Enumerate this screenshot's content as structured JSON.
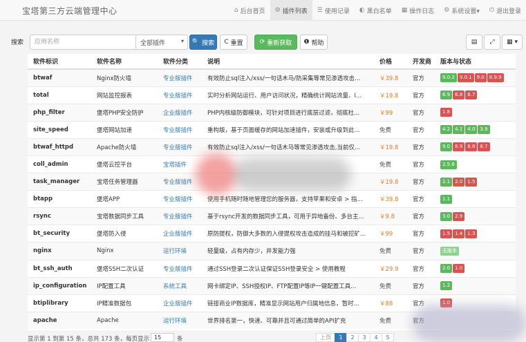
{
  "app": {
    "brand": "宝塔第三方云端管理中心"
  },
  "nav": [
    {
      "label": "后台首页",
      "icon": "⌂",
      "active": false
    },
    {
      "label": "插件列表",
      "icon": "⚙",
      "active": true
    },
    {
      "label": "使用记录",
      "icon": "☰",
      "active": false
    },
    {
      "label": "黑白名单",
      "icon": "◐",
      "active": false
    },
    {
      "label": "操作日志",
      "icon": "▦",
      "active": false
    },
    {
      "label": "系统设置▾",
      "icon": "⚙",
      "active": false
    },
    {
      "label": "退出登录",
      "icon": "⏻",
      "active": false
    }
  ],
  "toolbar": {
    "search_label": "搜索",
    "search_placeholder": "应用名称",
    "search_value": "",
    "category_select": "全部插件",
    "search_button": "搜索",
    "reset_button": "重置",
    "refresh_button": "重新获取",
    "help_button": "帮助",
    "icons": {
      "search": "🔍",
      "reset": "C",
      "refresh": "⟳",
      "help": "❶",
      "columns": "▤",
      "fullscreen": "⤢",
      "grid": "▦"
    }
  },
  "table": {
    "headers": [
      "软件标识",
      "软件名称",
      "软件分类",
      "说明",
      "价格",
      "开发商",
      "版本与状态"
    ],
    "rows": [
      {
        "id": "btwaf",
        "name": "Nginx防火墙",
        "category": "专业版插件",
        "desc": "有效防止sql注入/xss/一句话木马/防采集等常见渗透攻击...",
        "price": "￥39.8",
        "dev": "官方",
        "versions": [
          {
            "v": "9.0.2",
            "c": "green"
          },
          {
            "v": "9.0.1",
            "c": "red"
          },
          {
            "v": "9.0",
            "c": "red"
          },
          {
            "v": "8.9.9",
            "c": "red"
          }
        ]
      },
      {
        "id": "total",
        "name": "网站监控报表",
        "category": "专业版插件",
        "desc": "实时分析网站运行、用户访问状况，精确统计网站流量、I...",
        "price": "￥19.8",
        "dev": "官方",
        "versions": [
          {
            "v": "6.9",
            "c": "green"
          },
          {
            "v": "6.8",
            "c": "red"
          },
          {
            "v": "6.7",
            "c": "red"
          }
        ]
      },
      {
        "id": "php_filter",
        "name": "堡塔PHP安全防护",
        "category": "企业版插件",
        "desc": "PHP内核级防御模块，可针对项目进行底层过滤，彻底杜...",
        "price": "￥99",
        "dev": "官方",
        "versions": [
          {
            "v": "1.8",
            "c": "red"
          }
        ]
      },
      {
        "id": "site_speed",
        "name": "堡塔网站加速",
        "category": "专业版插件",
        "desc": "重构版，基于页面缓存的网站加速插件，安装或升级到此...",
        "price": "免费",
        "dev": "官方",
        "versions": [
          {
            "v": "4.2",
            "c": "green"
          },
          {
            "v": "4.1",
            "c": "green"
          },
          {
            "v": "4.0",
            "c": "green"
          },
          {
            "v": "3.9",
            "c": "green"
          }
        ]
      },
      {
        "id": "btwaf_httpd",
        "name": "Apache防火墙",
        "category": "专业版插件",
        "desc": "有效防止sql注入/xss/一句话木马等常见渗透攻击,当前仅...",
        "price": "￥19.8",
        "dev": "官方",
        "versions": [
          {
            "v": "9.0",
            "c": "green"
          },
          {
            "v": "8.9",
            "c": "red"
          },
          {
            "v": "8.8",
            "c": "red"
          },
          {
            "v": "8.7",
            "c": "red"
          }
        ]
      },
      {
        "id": "coll_admin",
        "name": "堡塔云控平台",
        "category": "宝塔插件",
        "desc": "",
        "price": "免费",
        "dev": "官方",
        "versions": [
          {
            "v": "2.5.6",
            "c": "green"
          }
        ]
      },
      {
        "id": "task_manager",
        "name": "宝塔任务管理器",
        "category": "专业版插件",
        "desc": "",
        "price": "￥19.8",
        "dev": "官方",
        "versions": [
          {
            "v": "2.1",
            "c": "green"
          },
          {
            "v": "2.0",
            "c": "red"
          },
          {
            "v": "1.5",
            "c": "red"
          }
        ]
      },
      {
        "id": "btapp",
        "name": "堡塔APP",
        "category": "专业版插件",
        "desc": "使用手机随时随地管理您的服务器，支持苹果和安卓 > 指...",
        "price": "￥39.8",
        "dev": "官方",
        "versions": [
          {
            "v": "1.1",
            "c": "green"
          }
        ]
      },
      {
        "id": "rsync",
        "name": "宝塔数据同步工具",
        "category": "专业版插件",
        "desc": "基于rsync开发的数据同步工具，可用于异地备份、多台主...",
        "price": "￥9.8",
        "dev": "官方",
        "versions": [
          {
            "v": "3.0",
            "c": "green"
          },
          {
            "v": "2.9",
            "c": "red"
          }
        ]
      },
      {
        "id": "bt_security",
        "name": "堡塔防入侵",
        "category": "企业版插件",
        "desc": "原防提权，防御大多数的入侵提权攻击造成的挂马和被挖矿...",
        "price": "￥99",
        "dev": "官方",
        "versions": [
          {
            "v": "1.5",
            "c": "red"
          },
          {
            "v": "1.4",
            "c": "red"
          },
          {
            "v": "1.3",
            "c": "red"
          }
        ]
      },
      {
        "id": "nginx",
        "name": "Nginx",
        "category": "运行环境",
        "desc": "轻量级，占有内存少，并发能力强",
        "price": "免费",
        "dev": "官方",
        "versions": [
          {
            "v": "无版本",
            "c": "lightgreen"
          }
        ]
      },
      {
        "id": "bt_ssh_auth",
        "name": "堡塔SSH二次认证",
        "category": "专业版插件",
        "desc": "通过SSH登录二次认证保证SSH登录安全 > 使用教程",
        "price": "￥29.9",
        "dev": "官方",
        "versions": [
          {
            "v": "2.0",
            "c": "green"
          },
          {
            "v": "1.0",
            "c": "red"
          }
        ]
      },
      {
        "id": "ip_configuration",
        "name": "IP配置工具",
        "category": "系统工具",
        "desc": "网卡绑定IP、SSH授权IP、FTP配置IP等IP一键配置工具...",
        "price": "免费",
        "dev": "官方",
        "versions": [
          {
            "v": "1.2",
            "c": "green"
          }
        ]
      },
      {
        "id": "btiplibrary",
        "name": "IP精准数据包",
        "category": "企业版插件",
        "desc": "链接商业IP数据库，精准显示网站用户归属地信息，暂时...",
        "price": "￥88",
        "dev": "官方",
        "versions": [
          {
            "v": "1.0",
            "c": "red"
          }
        ]
      },
      {
        "id": "apache",
        "name": "Apache",
        "category": "运行环境",
        "desc": "世界排名第一，快速、可靠并且可通过简单的API扩充",
        "price": "免费",
        "dev": "官方",
        "versions": []
      }
    ]
  },
  "footer": {
    "page_info": "显示第 1 到第 15 条，总共 173 条，每页显示",
    "per_page": "15",
    "per_page_suffix": "条",
    "pages": [
      "上页",
      "1",
      "2",
      "3",
      "4",
      "5"
    ]
  }
}
